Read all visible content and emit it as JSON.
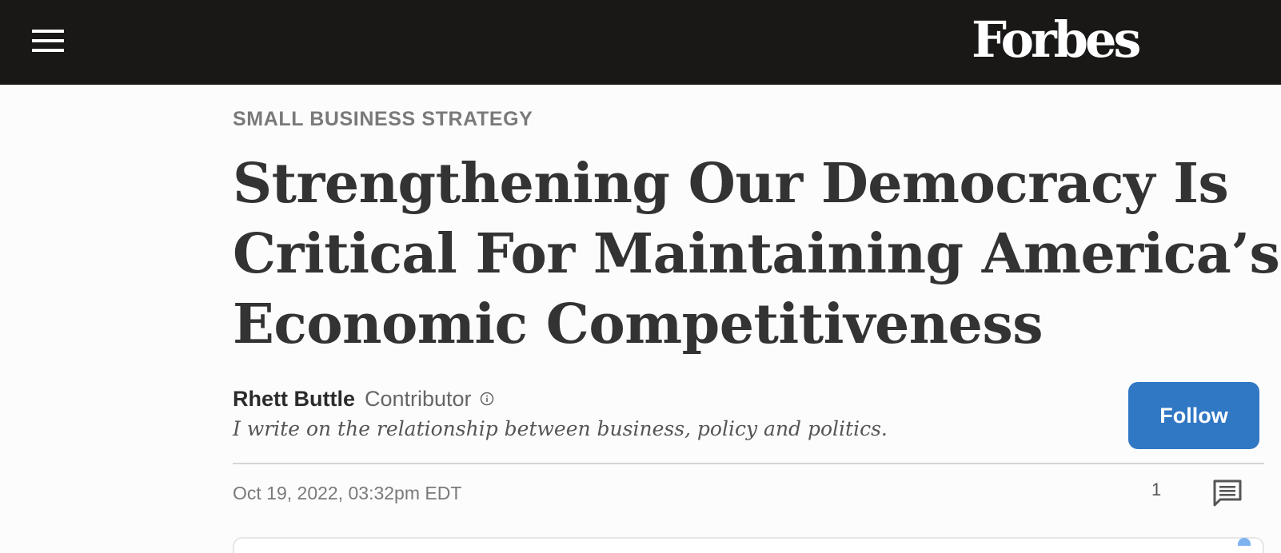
{
  "header": {
    "logo_text": "Forbes",
    "menu_icon": "hamburger-menu-icon",
    "background_color": "#1a1817"
  },
  "article": {
    "section": "SMALL BUSINESS STRATEGY",
    "headline_lines": [
      "Strengthening Our Democracy Is",
      "Critical For Maintaining America’s",
      "Economic Competitiveness"
    ],
    "author": {
      "name": "Rhett Buttle",
      "role": "Contributor",
      "info_icon": "info-circle-icon",
      "tagline": "I write on the relationship between business, policy and politics."
    },
    "follow_label": "Follow",
    "follow_color": "#3077c4",
    "timestamp": "Oct 19, 2022, 03:32pm EDT",
    "comments": {
      "count": "1",
      "icon": "comment-icon"
    }
  }
}
